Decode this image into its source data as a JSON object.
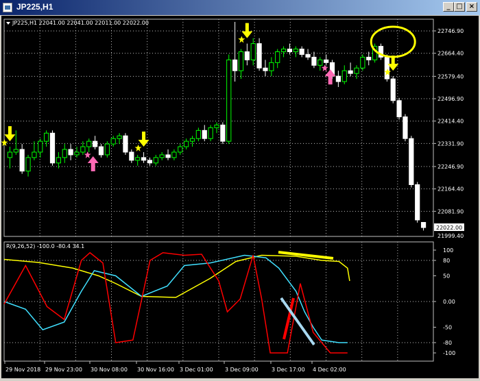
{
  "window": {
    "title": "JP225,H1",
    "minimize_glyph": "_",
    "maximize_glyph": "□",
    "close_glyph": "×"
  },
  "chart_info": "JP225,H1  22041.00 22041.00 22011.00 22022.00",
  "oscillator_info": "R(9,26,52) -100.0 -80.4 34.1",
  "price_axis": [
    "22746.90",
    "22664.40",
    "22579.40",
    "22496.90",
    "22414.40",
    "22331.90",
    "22246.90",
    "22164.40",
    "22081.90"
  ],
  "current_price": "22022.00",
  "price_low_label": "21999.40",
  "osc_axis": [
    "100",
    "80",
    "50",
    "0.00",
    "-50",
    "-80",
    "-100"
  ],
  "time_axis": [
    "29 Nov 2018",
    "29 Nov 23:00",
    "30 Nov 08:00",
    "30 Nov 16:00",
    "3 Dec 01:00",
    "3 Dec 09:00",
    "3 Dec 17:00",
    "4 Dec 02:00"
  ],
  "colors": {
    "bull_candle": "#00ff00",
    "bear_candle": "#ffffff",
    "grid": "#c0c0c0",
    "signal_arrow_sell": "#ffff00",
    "signal_arrow_buy": "#ff69b4",
    "osc_red": "#ff0000",
    "osc_cyan": "#40e0ff",
    "osc_yellow": "#ffff00"
  },
  "chart_data": {
    "type": "candlestick",
    "series_name": "JP225,H1",
    "last": {
      "open": 22041.0,
      "high": 22041.0,
      "low": 22011.0,
      "close": 22022.0
    },
    "ylim": [
      21999.4,
      22790
    ],
    "candles": [
      [
        22280,
        22320,
        22240,
        22300
      ],
      [
        22300,
        22380,
        22290,
        22310
      ],
      [
        22310,
        22330,
        22220,
        22230
      ],
      [
        22230,
        22290,
        22210,
        22280
      ],
      [
        22280,
        22340,
        22270,
        22300
      ],
      [
        22300,
        22350,
        22280,
        22340
      ],
      [
        22340,
        22380,
        22320,
        22370
      ],
      [
        22370,
        22380,
        22250,
        22260
      ],
      [
        22260,
        22300,
        22240,
        22280
      ],
      [
        22280,
        22330,
        22260,
        22310
      ],
      [
        22310,
        22330,
        22270,
        22290
      ],
      [
        22290,
        22320,
        22280,
        22300
      ],
      [
        22300,
        22340,
        22290,
        22320
      ],
      [
        22320,
        22350,
        22300,
        22340
      ],
      [
        22340,
        22360,
        22310,
        22320
      ],
      [
        22320,
        22330,
        22280,
        22290
      ],
      [
        22290,
        22340,
        22280,
        22330
      ],
      [
        22330,
        22360,
        22320,
        22350
      ],
      [
        22350,
        22370,
        22330,
        22360
      ],
      [
        22360,
        22370,
        22290,
        22300
      ],
      [
        22300,
        22310,
        22260,
        22270
      ],
      [
        22270,
        22290,
        22250,
        22280
      ],
      [
        22280,
        22300,
        22260,
        22270
      ],
      [
        22270,
        22280,
        22250,
        22260
      ],
      [
        22260,
        22290,
        22250,
        22280
      ],
      [
        22280,
        22300,
        22270,
        22290
      ],
      [
        22290,
        22310,
        22270,
        22280
      ],
      [
        22280,
        22310,
        22270,
        22300
      ],
      [
        22300,
        22330,
        22290,
        22320
      ],
      [
        22320,
        22350,
        22310,
        22340
      ],
      [
        22340,
        22360,
        22320,
        22350
      ],
      [
        22350,
        22390,
        22340,
        22380
      ],
      [
        22380,
        22400,
        22340,
        22350
      ],
      [
        22350,
        22400,
        22340,
        22390
      ],
      [
        22390,
        22410,
        22370,
        22400
      ],
      [
        22400,
        22410,
        22330,
        22340
      ],
      [
        22340,
        22660,
        22330,
        22640
      ],
      [
        22640,
        22780,
        22560,
        22600
      ],
      [
        22600,
        22680,
        22570,
        22670
      ],
      [
        22670,
        22700,
        22620,
        22640
      ],
      [
        22640,
        22720,
        22620,
        22700
      ],
      [
        22700,
        22720,
        22600,
        22610
      ],
      [
        22610,
        22640,
        22580,
        22600
      ],
      [
        22600,
        22650,
        22580,
        22630
      ],
      [
        22630,
        22680,
        22610,
        22670
      ],
      [
        22670,
        22690,
        22650,
        22680
      ],
      [
        22680,
        22700,
        22660,
        22670
      ],
      [
        22670,
        22690,
        22650,
        22680
      ],
      [
        22680,
        22690,
        22650,
        22660
      ],
      [
        22660,
        22680,
        22640,
        22650
      ],
      [
        22650,
        22670,
        22610,
        22620
      ],
      [
        22620,
        22650,
        22600,
        22640
      ],
      [
        22640,
        22660,
        22620,
        22630
      ],
      [
        22630,
        22640,
        22570,
        22580
      ],
      [
        22580,
        22600,
        22540,
        22560
      ],
      [
        22560,
        22620,
        22550,
        22600
      ],
      [
        22600,
        22630,
        22580,
        22590
      ],
      [
        22590,
        22620,
        22570,
        22610
      ],
      [
        22610,
        22660,
        22600,
        22650
      ],
      [
        22650,
        22670,
        22620,
        22640
      ],
      [
        22640,
        22700,
        22630,
        22690
      ],
      [
        22690,
        22700,
        22640,
        22650
      ],
      [
        22650,
        22660,
        22560,
        22570
      ],
      [
        22570,
        22580,
        22480,
        22490
      ],
      [
        22490,
        22500,
        22420,
        22430
      ],
      [
        22430,
        22440,
        22340,
        22350
      ],
      [
        22350,
        22360,
        22170,
        22180
      ],
      [
        22180,
        22190,
        22040,
        22050
      ],
      [
        22041,
        22041,
        22011,
        22022
      ]
    ],
    "sell_arrows": [
      0,
      22,
      39,
      63
    ],
    "buy_arrows": [
      13,
      52
    ],
    "oscillator": {
      "scale": [
        -100,
        100
      ],
      "levels": [
        100,
        80,
        50,
        0,
        -50,
        -80,
        -100
      ]
    }
  }
}
